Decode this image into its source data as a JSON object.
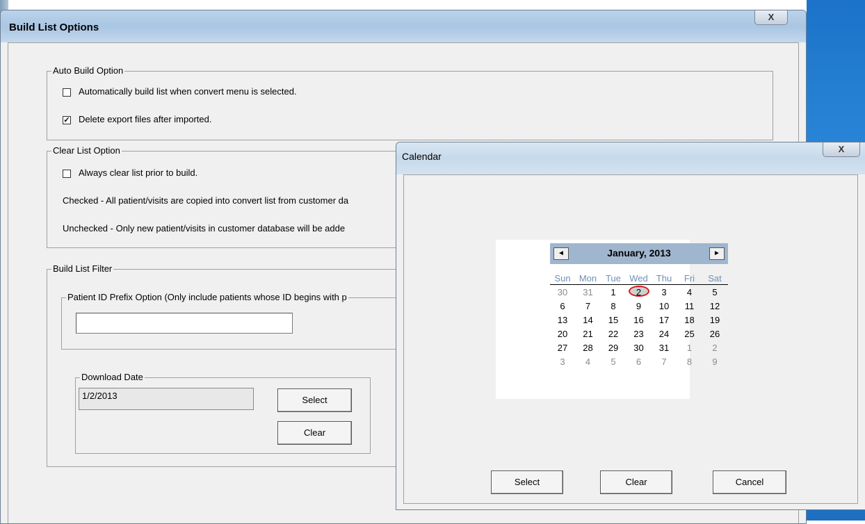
{
  "main_window": {
    "title": "Build List Options",
    "close_label": "X"
  },
  "auto_build": {
    "legend": "Auto Build Option",
    "option1": {
      "label": "Automatically build list when convert menu is selected.",
      "checked": false
    },
    "option2": {
      "label": "Delete export files after imported.",
      "checked": true
    }
  },
  "clear_list": {
    "legend": "Clear List Option",
    "option1": {
      "label": "Always clear list prior to build.",
      "checked": false
    },
    "note_checked": "Checked - All patient/visits are copied into convert list from customer da",
    "note_unchecked": "Unchecked - Only new patient/visits in customer database will be adde"
  },
  "filter": {
    "legend": "Build List Filter",
    "prefix_legend": "Patient ID Prefix Option (Only include patients whose ID begins with p",
    "prefix_value": ""
  },
  "download_date": {
    "legend": "Download Date",
    "value": "1/2/2013",
    "select_label": "Select",
    "clear_label": "Clear"
  },
  "calendar_dialog": {
    "title": "Calendar",
    "close_label": "X",
    "month_title": "January, 2013",
    "prev_icon": "◄",
    "next_icon": "►",
    "dow": [
      "Sun",
      "Mon",
      "Tue",
      "Wed",
      "Thu",
      "Fri",
      "Sat"
    ],
    "weeks": [
      [
        {
          "d": "30",
          "o": true
        },
        {
          "d": "31",
          "o": true
        },
        {
          "d": "1"
        },
        {
          "d": "2",
          "s": true
        },
        {
          "d": "3"
        },
        {
          "d": "4"
        },
        {
          "d": "5"
        }
      ],
      [
        {
          "d": "6"
        },
        {
          "d": "7"
        },
        {
          "d": "8"
        },
        {
          "d": "9"
        },
        {
          "d": "10"
        },
        {
          "d": "11"
        },
        {
          "d": "12"
        }
      ],
      [
        {
          "d": "13"
        },
        {
          "d": "14"
        },
        {
          "d": "15"
        },
        {
          "d": "16"
        },
        {
          "d": "17"
        },
        {
          "d": "18"
        },
        {
          "d": "19"
        }
      ],
      [
        {
          "d": "20"
        },
        {
          "d": "21"
        },
        {
          "d": "22"
        },
        {
          "d": "23"
        },
        {
          "d": "24"
        },
        {
          "d": "25"
        },
        {
          "d": "26"
        }
      ],
      [
        {
          "d": "27"
        },
        {
          "d": "28"
        },
        {
          "d": "29"
        },
        {
          "d": "30"
        },
        {
          "d": "31"
        },
        {
          "d": "1",
          "o": true
        },
        {
          "d": "2",
          "o": true
        }
      ],
      [
        {
          "d": "3",
          "o": true
        },
        {
          "d": "4",
          "o": true
        },
        {
          "d": "5",
          "o": true
        },
        {
          "d": "6",
          "o": true
        },
        {
          "d": "7",
          "o": true
        },
        {
          "d": "8",
          "o": true
        },
        {
          "d": "9",
          "o": true
        }
      ]
    ],
    "select_label": "Select",
    "clear_label": "Clear",
    "cancel_label": "Cancel"
  },
  "colors": {
    "selection_ring": "#d61c1c",
    "calendar_header": "#a0b6ce",
    "dow_text": "#6f8fb7"
  }
}
